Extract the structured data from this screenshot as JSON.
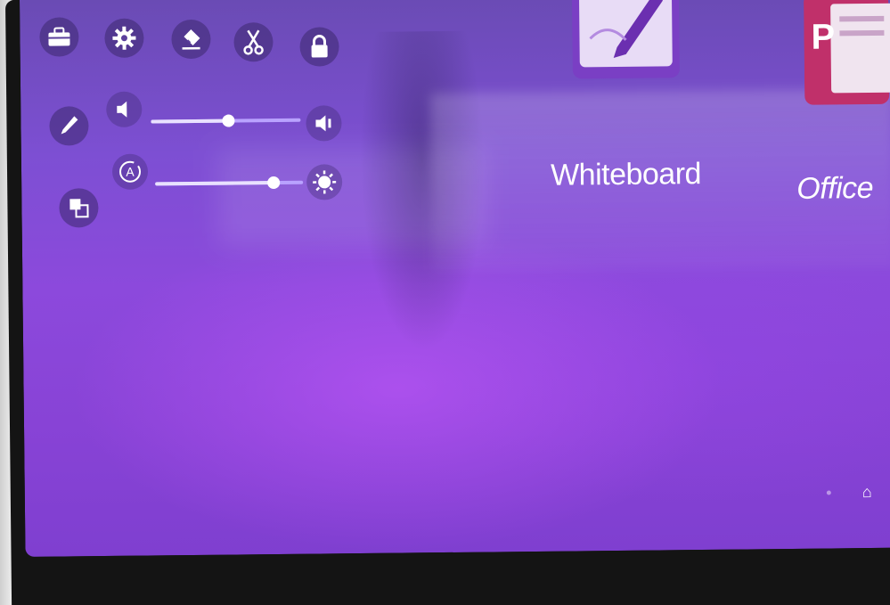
{
  "toolbar": {
    "top_row": [
      {
        "name": "toolbox-icon",
        "glyph": "toolbox"
      },
      {
        "name": "settings-gear-icon",
        "glyph": "gear"
      },
      {
        "name": "eraser-icon",
        "glyph": "eraser"
      },
      {
        "name": "scissors-icon",
        "glyph": "scissors"
      },
      {
        "name": "lock-icon",
        "glyph": "lock"
      }
    ],
    "side_column": [
      {
        "name": "pen-icon",
        "glyph": "pen"
      },
      {
        "name": "window-switch-icon",
        "glyph": "windows"
      }
    ]
  },
  "sliders": {
    "volume": {
      "level": 0.52,
      "low_icon": "speaker-low-icon",
      "high_icon": "speaker-high-icon"
    },
    "brightness": {
      "level": 0.8,
      "auto_icon": "auto-brightness-icon",
      "high_icon": "sun-icon"
    }
  },
  "apps": [
    {
      "label": "Whiteboard",
      "icon": "whiteboard-app-icon",
      "color": "#9b59d6"
    },
    {
      "label": "Office",
      "icon": "office-app-icon",
      "color": "#c0306a"
    }
  ],
  "home": {
    "icon": "home-icon"
  },
  "colors": {
    "screen_purple": "#8c49dc",
    "slider_track": "#b9a2ff",
    "bezel": "#141414"
  }
}
